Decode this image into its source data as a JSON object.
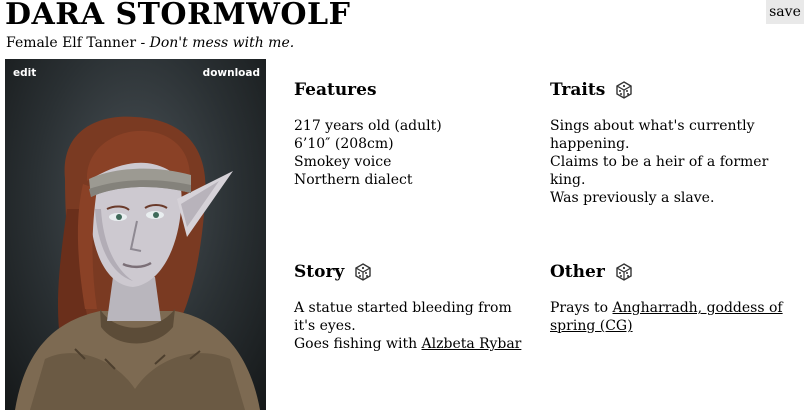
{
  "character": {
    "name": "DARA STORMWOLF",
    "description": "Female Elf Tanner - ",
    "tagline": "Don't mess with me."
  },
  "toolbar": {
    "save_label": "save"
  },
  "portrait": {
    "edit_label": "edit",
    "download_label": "download"
  },
  "features": {
    "heading": "Features",
    "lines": [
      "217 years old (adult)",
      "6’10″ (208cm)",
      "Smokey voice",
      "Northern dialect"
    ]
  },
  "traits": {
    "heading": "Traits",
    "dice_icon": "dice-icon",
    "lines": [
      "Sings about what's currently happening.",
      "Claims to be a heir of a former king.",
      "Was previously a slave."
    ]
  },
  "story": {
    "heading": "Story",
    "dice_icon": "dice-icon",
    "line1": "A statue started bleeding from it's eyes.",
    "line2_prefix": "Goes fishing with ",
    "line2_link": "Alzbeta Rybar"
  },
  "other": {
    "heading": "Other",
    "dice_icon": "dice-icon",
    "prefix": "Prays to ",
    "link": "Angharradh, goddess of spring (CG)"
  }
}
